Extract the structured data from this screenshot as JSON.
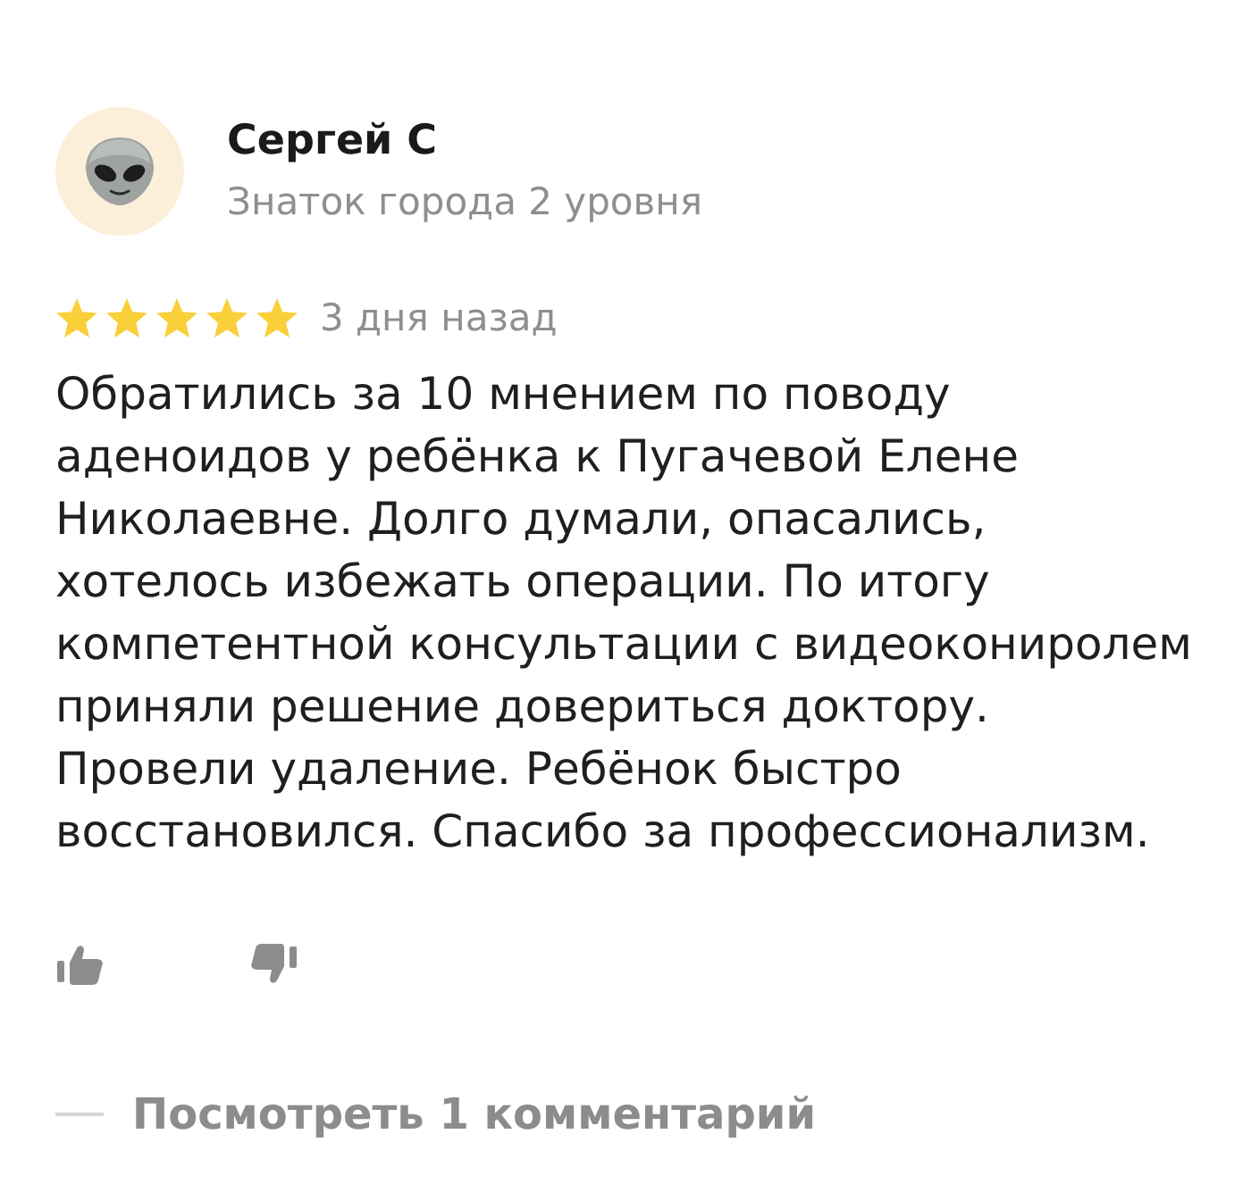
{
  "author": {
    "name": "Сергей С",
    "status": "Знаток города 2 уровня"
  },
  "review": {
    "stars": 5,
    "date": "3 дня назад",
    "text": "Обратились за 10 мнением по поводу\nаденоидов у ребёнка к Пугачевой Елене\nНиколаевне. Долго думали, опасались,\nхотелось избежать операции. По итогу\nкомпетентной консультации с видеокониролем\nприняли решение довериться доктору.\nПровели удаление. Ребёнок быстро\nвосстановился. Спасибо за профессионализм."
  },
  "comments": {
    "link": "Посмотреть 1 комментарий"
  }
}
